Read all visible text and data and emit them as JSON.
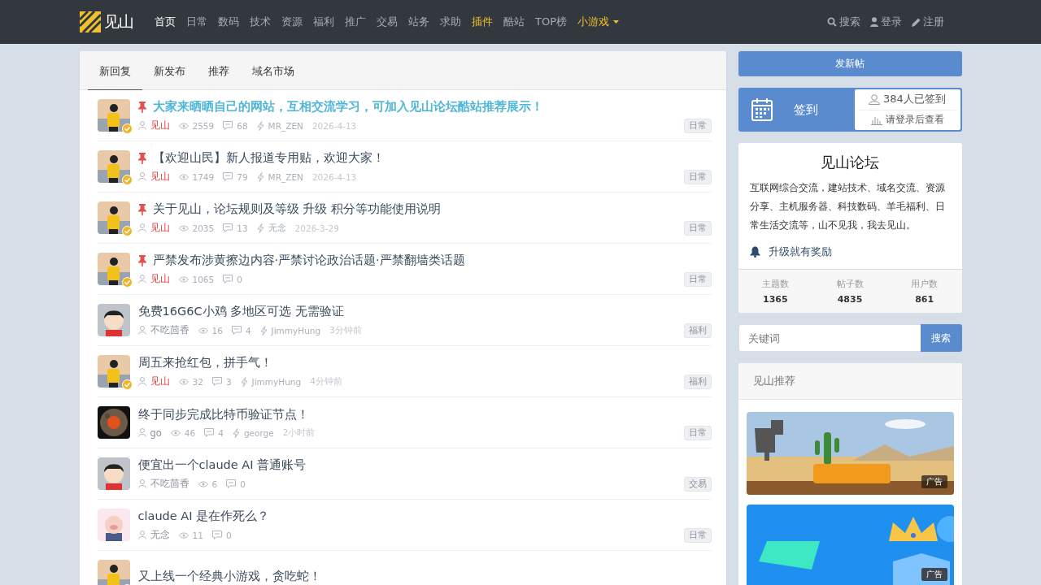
{
  "nav": {
    "logo_text": "见山",
    "items": [
      {
        "label": "首页",
        "selected": true,
        "highlight": false,
        "dropdown": false
      },
      {
        "label": "日常",
        "selected": false,
        "highlight": false,
        "dropdown": false
      },
      {
        "label": "数码",
        "selected": false,
        "highlight": false,
        "dropdown": false
      },
      {
        "label": "技术",
        "selected": false,
        "highlight": false,
        "dropdown": false
      },
      {
        "label": "资源",
        "selected": false,
        "highlight": false,
        "dropdown": false
      },
      {
        "label": "福利",
        "selected": false,
        "highlight": false,
        "dropdown": false
      },
      {
        "label": "推广",
        "selected": false,
        "highlight": false,
        "dropdown": false
      },
      {
        "label": "交易",
        "selected": false,
        "highlight": false,
        "dropdown": false
      },
      {
        "label": "站务",
        "selected": false,
        "highlight": false,
        "dropdown": false
      },
      {
        "label": "求助",
        "selected": false,
        "highlight": false,
        "dropdown": false
      },
      {
        "label": "插件",
        "selected": false,
        "highlight": true,
        "dropdown": false
      },
      {
        "label": "酷站",
        "selected": false,
        "highlight": false,
        "dropdown": false
      },
      {
        "label": "TOP榜",
        "selected": false,
        "highlight": false,
        "dropdown": false
      },
      {
        "label": "小游戏",
        "selected": false,
        "highlight": true,
        "dropdown": true
      }
    ],
    "actions": [
      {
        "kind": "search",
        "label": "搜索"
      },
      {
        "kind": "login",
        "label": "登录"
      },
      {
        "kind": "register",
        "label": "注册"
      }
    ]
  },
  "tabs": [
    {
      "label": "新回复",
      "selected": true
    },
    {
      "label": "新发布",
      "selected": false
    },
    {
      "label": "推荐",
      "selected": false
    },
    {
      "label": "域名市场",
      "selected": false
    }
  ],
  "threads": [
    {
      "avatar": {
        "kind": "person"
      },
      "verified": true,
      "pinned": true,
      "highlighted": true,
      "title": "大家来晒晒自己的网站，互相交流学习，可加入见山论坛酷站推荐展示！",
      "author": "见山",
      "views": "2559",
      "replies": "68",
      "last_replier": "MR_ZEN",
      "time": "2026-4-13",
      "tag": "日常"
    },
    {
      "avatar": {
        "kind": "person"
      },
      "verified": true,
      "pinned": true,
      "highlighted": false,
      "title": "【欢迎山民】新人报道专用贴，欢迎大家！",
      "author": "见山",
      "views": "1749",
      "replies": "79",
      "last_replier": "MR_ZEN",
      "time": "2026-4-13",
      "tag": "日常"
    },
    {
      "avatar": {
        "kind": "person"
      },
      "verified": true,
      "pinned": true,
      "highlighted": false,
      "title": "关于见山，论坛规则及等级 升级 积分等功能使用说明",
      "author": "见山",
      "views": "2035",
      "replies": "13",
      "last_replier": "无念",
      "time": "2026-3-29",
      "tag": "日常"
    },
    {
      "avatar": {
        "kind": "person"
      },
      "verified": true,
      "pinned": true,
      "highlighted": false,
      "title": "严禁发布涉黄擦边内容·严禁讨论政治话题·严禁翻墙类话题",
      "author": "见山",
      "views": "1065",
      "replies": "0",
      "tag": "日常"
    },
    {
      "avatar": {
        "kind": "cartoon"
      },
      "verified": false,
      "pinned": false,
      "highlighted": false,
      "title": "免费16G6C小鸡 多地区可选 无需验证",
      "author": "不吃茴香",
      "views": "16",
      "replies": "4",
      "last_replier": "JimmyHung",
      "time": "3分钟前",
      "tag": "福利"
    },
    {
      "avatar": {
        "kind": "person"
      },
      "verified": true,
      "pinned": false,
      "highlighted": false,
      "title": "周五来抢红包，拼手气！",
      "author": "见山",
      "views": "32",
      "replies": "3",
      "last_replier": "JimmyHung",
      "time": "4分钟前",
      "tag": "福利"
    },
    {
      "avatar": {
        "kind": "moon"
      },
      "verified": false,
      "pinned": false,
      "highlighted": false,
      "title": "终于同步完成比特币验证节点！",
      "author": "go",
      "views": "46",
      "replies": "4",
      "last_replier": "george",
      "time": "2小时前",
      "tag": "日常"
    },
    {
      "avatar": {
        "kind": "cartoon"
      },
      "verified": false,
      "pinned": false,
      "highlighted": false,
      "title": "便宜出一个claude AI 普通账号",
      "author": "不吃茴香",
      "views": "6",
      "replies": "0",
      "tag": "交易"
    },
    {
      "avatar": {
        "kind": "pig"
      },
      "verified": false,
      "pinned": false,
      "highlighted": false,
      "title": "claude AI 是在作死么？",
      "author": "无念",
      "views": "11",
      "replies": "0",
      "tag": "日常"
    },
    {
      "avatar": {
        "kind": "person"
      },
      "verified": true,
      "pinned": false,
      "highlighted": false,
      "title": "又上线一个经典小游戏，贪吃蛇！"
    }
  ],
  "sidebar": {
    "new_post": "发新帖",
    "checkin": {
      "label": "签到",
      "count": "384人已签到",
      "note": "请登录后查看"
    },
    "about": {
      "title": "见山论坛",
      "text": "互联网综合交流，建站技术、域名交流、资源分享、主机服务器、科技数码、羊毛福利、日常生活交流等，山不见我，我去见山。",
      "link": "升级就有奖励",
      "stats": [
        {
          "label": "主题数",
          "value": "1365"
        },
        {
          "label": "帖子数",
          "value": "4835"
        },
        {
          "label": "用户数",
          "value": "861"
        }
      ]
    },
    "search": {
      "placeholder": "关键词",
      "button": "搜索"
    },
    "recommend": {
      "title": "见山推荐",
      "ads": [
        {
          "kind": "desert",
          "badge": "广告"
        },
        {
          "kind": "ranking",
          "badge": "广告"
        }
      ]
    }
  }
}
